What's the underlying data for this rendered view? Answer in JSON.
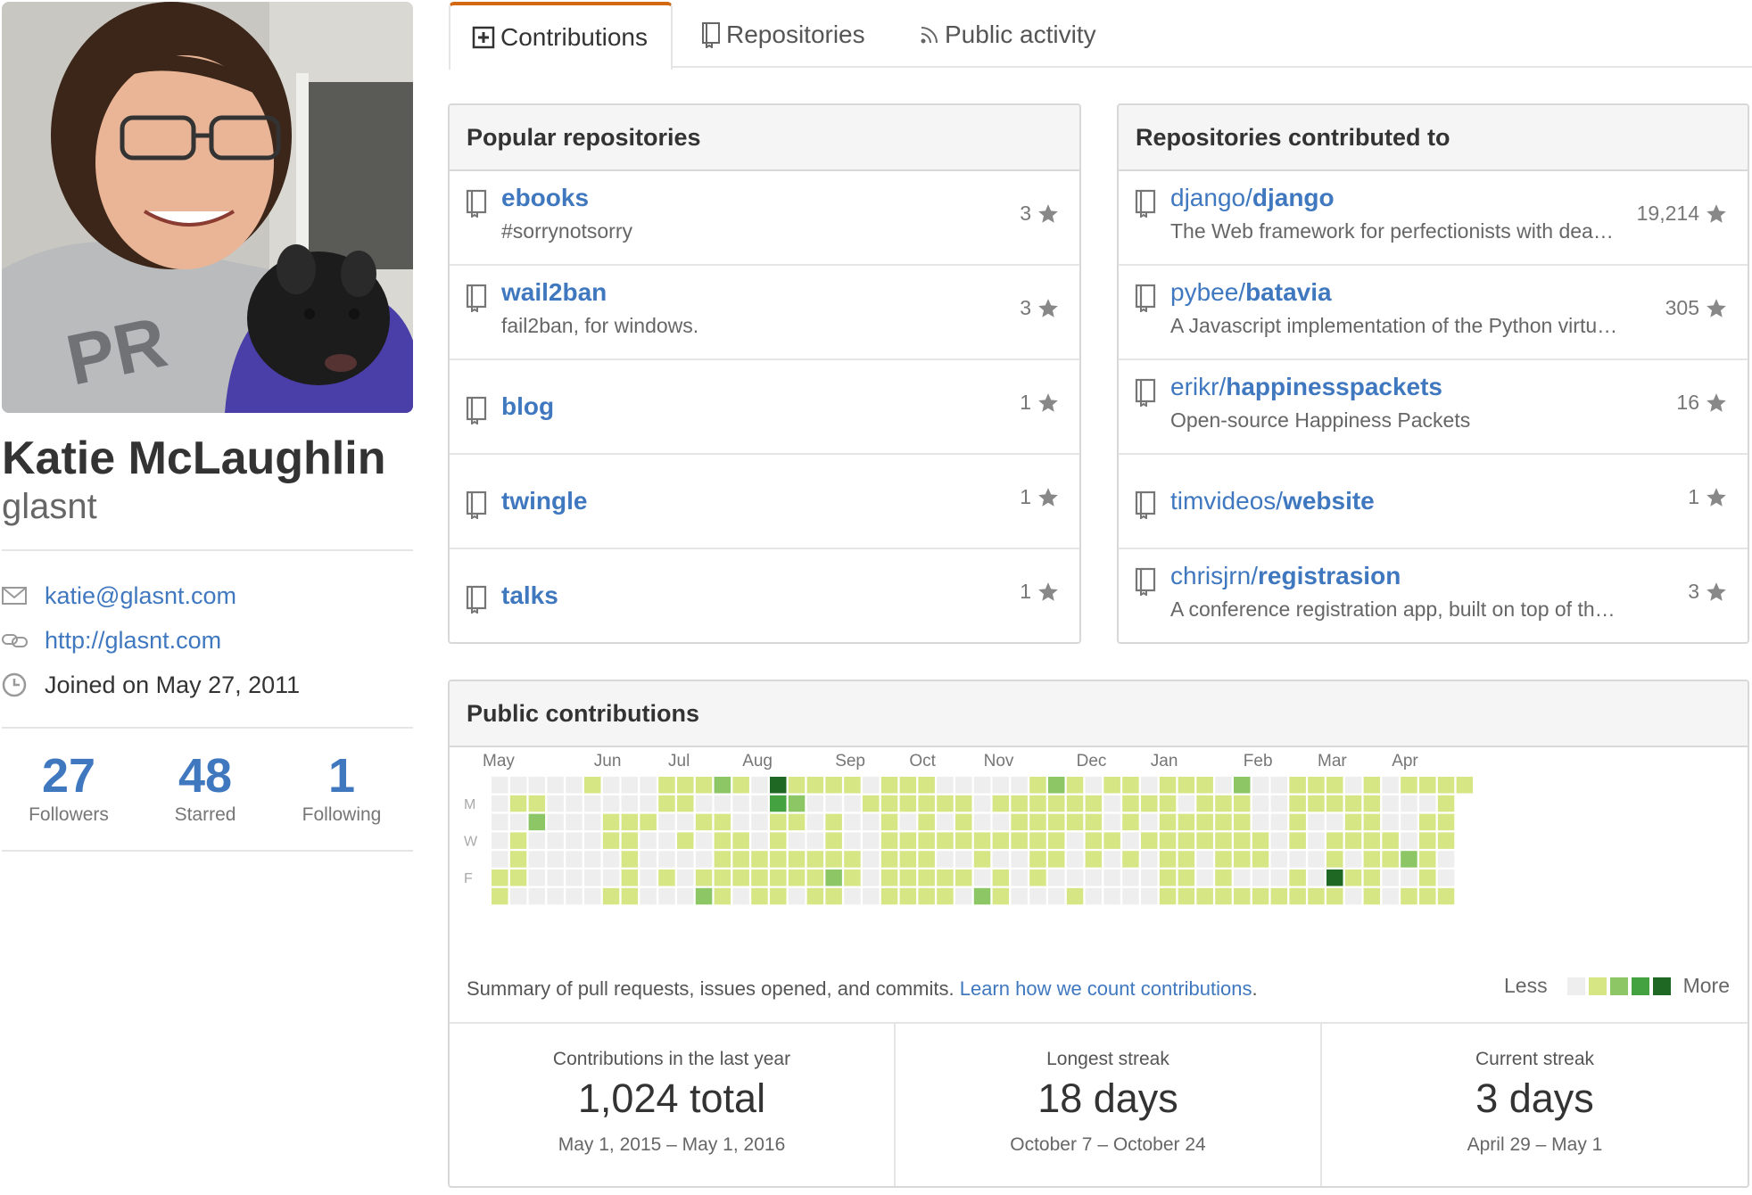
{
  "profile": {
    "fullname": "Katie McLaughlin",
    "username": "glasnt",
    "email": "katie@glasnt.com",
    "website": "http://glasnt.com",
    "joined": "Joined on May 27, 2011",
    "stats": [
      {
        "value": "27",
        "label": "Followers"
      },
      {
        "value": "48",
        "label": "Starred"
      },
      {
        "value": "1",
        "label": "Following"
      }
    ]
  },
  "tabs": {
    "contributions": "Contributions",
    "repositories": "Repositories",
    "activity": "Public activity"
  },
  "popular": {
    "title": "Popular repositories",
    "repos": [
      {
        "name": "ebooks",
        "description": "#sorrynotsorry",
        "stars": "3"
      },
      {
        "name": "wail2ban",
        "description": "fail2ban, for windows.",
        "stars": "3"
      },
      {
        "name": "blog",
        "stars": "1"
      },
      {
        "name": "twingle",
        "stars": "1"
      },
      {
        "name": "talks",
        "stars": "1"
      }
    ]
  },
  "contributed": {
    "title": "Repositories contributed to",
    "repos": [
      {
        "owner": "django/",
        "name": "django",
        "description": "The Web framework for perfectionists with dea…",
        "stars": "19,214"
      },
      {
        "owner": "pybee/",
        "name": "batavia",
        "description": "A Javascript implementation of the Python virtu…",
        "stars": "305"
      },
      {
        "owner": "erikr/",
        "name": "happinesspackets",
        "description": "Open-source Happiness Packets",
        "stars": "16"
      },
      {
        "owner": "timvideos/",
        "name": "website",
        "stars": "1"
      },
      {
        "owner": "chrisjrn/",
        "name": "registrasion",
        "description": "A conference registration app, built on top of th…",
        "stars": "3"
      }
    ]
  },
  "contributions": {
    "title": "Public contributions",
    "summary": "Summary of pull requests, issues opened, and commits.",
    "learn_link": "Learn how we count contributions",
    "learn_after": ".",
    "legend_less": "Less",
    "legend_more": "More",
    "months": [
      "May",
      "Jun",
      "Jul",
      "Aug",
      "Sep",
      "Oct",
      "Nov",
      "Dec",
      "Jan",
      "Feb",
      "Mar",
      "Apr"
    ],
    "day_labels": [
      "M",
      "W",
      "F"
    ],
    "stats": [
      {
        "label": "Contributions in the last year",
        "value": "1,024 total",
        "range": "May 1, 2015 – May 1, 2016"
      },
      {
        "label": "Longest streak",
        "value": "18 days",
        "range": "October 7 – October 24"
      },
      {
        "label": "Current streak",
        "value": "3 days",
        "range": "April 29 – May 1"
      }
    ]
  },
  "colors": {
    "link": "#4078c0",
    "level0": "#eeeeee",
    "level1": "#d6e685",
    "level2": "#8cc665",
    "level3": "#44a340",
    "level4": "#1e6823",
    "tab_accent": "#d26911"
  },
  "chart_data": {
    "type": "heatmap",
    "title": "Public contributions",
    "rows": [
      "Sun",
      "Mon",
      "Tue",
      "Wed",
      "Thu",
      "Fri",
      "Sat"
    ],
    "levels": [
      0,
      1,
      2,
      3,
      4
    ],
    "weeks": [
      [
        0,
        0,
        0,
        0,
        0,
        1,
        1
      ],
      [
        0,
        1,
        0,
        1,
        1,
        1,
        0
      ],
      [
        0,
        1,
        2,
        0,
        0,
        0,
        0
      ],
      [
        0,
        0,
        0,
        0,
        0,
        0,
        0
      ],
      [
        0,
        0,
        0,
        0,
        0,
        0,
        0
      ],
      [
        1,
        0,
        0,
        0,
        0,
        0,
        0
      ],
      [
        0,
        0,
        1,
        1,
        0,
        0,
        1
      ],
      [
        0,
        0,
        1,
        1,
        1,
        1,
        1
      ],
      [
        0,
        0,
        1,
        0,
        0,
        0,
        0
      ],
      [
        1,
        1,
        0,
        0,
        0,
        1,
        0
      ],
      [
        1,
        1,
        0,
        1,
        0,
        0,
        0
      ],
      [
        1,
        0,
        1,
        0,
        0,
        1,
        2
      ],
      [
        2,
        0,
        1,
        1,
        1,
        1,
        1
      ],
      [
        1,
        0,
        0,
        1,
        1,
        1,
        0
      ],
      [
        0,
        0,
        0,
        0,
        1,
        1,
        1
      ],
      [
        4,
        3,
        1,
        1,
        1,
        1,
        1
      ],
      [
        1,
        2,
        1,
        0,
        1,
        1,
        0
      ],
      [
        1,
        0,
        0,
        0,
        1,
        1,
        1
      ],
      [
        1,
        0,
        1,
        1,
        1,
        2,
        1
      ],
      [
        1,
        0,
        0,
        0,
        1,
        1,
        0
      ],
      [
        0,
        1,
        0,
        0,
        0,
        0,
        0
      ],
      [
        1,
        1,
        1,
        1,
        1,
        1,
        1
      ],
      [
        1,
        1,
        0,
        1,
        1,
        1,
        1
      ],
      [
        1,
        1,
        1,
        1,
        1,
        1,
        1
      ],
      [
        0,
        1,
        0,
        1,
        0,
        1,
        1
      ],
      [
        0,
        1,
        1,
        1,
        0,
        1,
        0
      ],
      [
        0,
        0,
        0,
        1,
        1,
        0,
        2
      ],
      [
        0,
        1,
        0,
        1,
        0,
        1,
        1
      ],
      [
        0,
        1,
        1,
        1,
        0,
        0,
        0
      ],
      [
        1,
        1,
        1,
        1,
        1,
        1,
        0
      ],
      [
        2,
        1,
        1,
        1,
        1,
        0,
        0
      ],
      [
        1,
        1,
        1,
        0,
        0,
        0,
        1
      ],
      [
        0,
        1,
        1,
        1,
        1,
        0,
        0
      ],
      [
        1,
        0,
        0,
        1,
        0,
        0,
        0
      ],
      [
        1,
        1,
        1,
        0,
        1,
        0,
        0
      ],
      [
        0,
        1,
        0,
        1,
        0,
        0,
        0
      ],
      [
        1,
        1,
        1,
        1,
        1,
        1,
        1
      ],
      [
        1,
        0,
        1,
        1,
        1,
        1,
        1
      ],
      [
        1,
        1,
        1,
        1,
        0,
        0,
        1
      ],
      [
        0,
        1,
        1,
        1,
        1,
        1,
        1
      ],
      [
        2,
        1,
        1,
        1,
        1,
        0,
        1
      ],
      [
        0,
        0,
        0,
        1,
        1,
        0,
        1
      ],
      [
        0,
        0,
        0,
        0,
        0,
        0,
        1
      ],
      [
        1,
        1,
        1,
        1,
        0,
        1,
        1
      ],
      [
        1,
        1,
        0,
        0,
        0,
        0,
        1
      ],
      [
        1,
        1,
        0,
        1,
        1,
        4,
        1
      ],
      [
        0,
        1,
        1,
        1,
        0,
        1,
        0
      ],
      [
        1,
        1,
        1,
        1,
        1,
        1,
        1
      ],
      [
        0,
        0,
        0,
        1,
        1,
        0,
        0
      ],
      [
        1,
        0,
        0,
        0,
        2,
        0,
        1
      ],
      [
        1,
        0,
        1,
        1,
        1,
        1,
        1
      ],
      [
        1,
        1,
        1,
        1,
        0,
        0,
        1
      ],
      [
        1
      ]
    ]
  }
}
